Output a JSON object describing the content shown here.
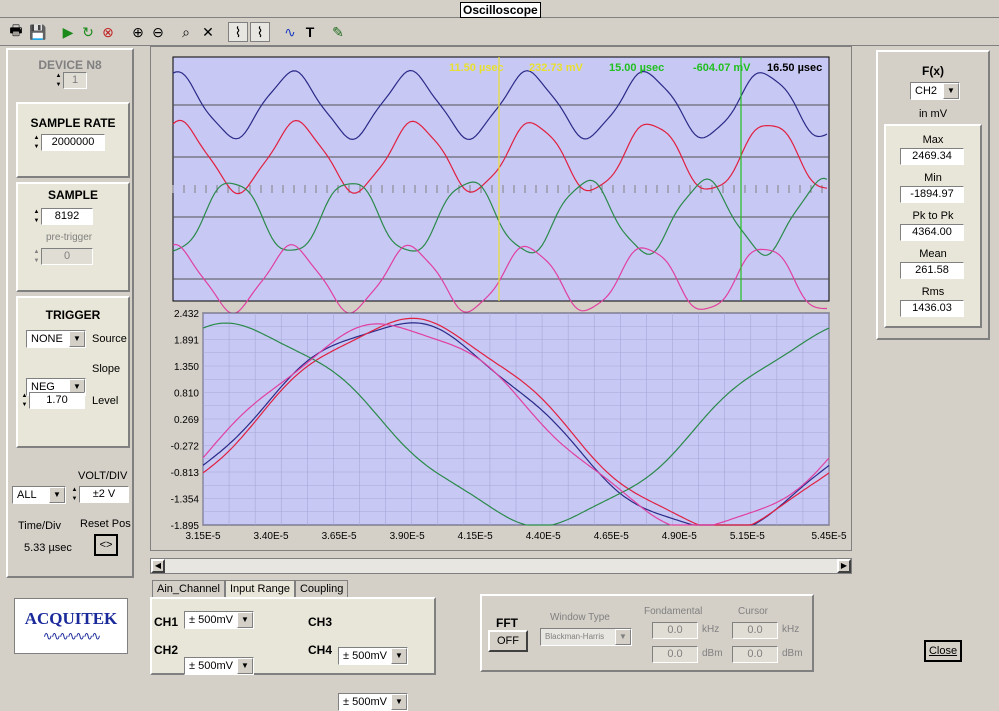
{
  "window": {
    "title": "Oscilloscope"
  },
  "toolbar": [
    "print-icon",
    "save-icon",
    "play-icon",
    "step-icon",
    "stop-icon",
    "zoom-in-icon",
    "zoom-out-icon",
    "zoom-icon",
    "cross-icon",
    "cursor1-icon",
    "cursor2-icon",
    "wave-icon",
    "text-icon",
    "pin-icon"
  ],
  "device": {
    "label": "DEVICE N8",
    "value": "1"
  },
  "sample_rate": {
    "label": "SAMPLE RATE",
    "value": "2000000"
  },
  "sample": {
    "label": "SAMPLE",
    "value": "8192",
    "pretrigger_label": "pre-trigger",
    "pretrigger_value": "0"
  },
  "trigger": {
    "label": "TRIGGER",
    "source": "NONE",
    "source_label": "Source",
    "slope": "NEG",
    "slope_label": "Slope",
    "level": "1.70",
    "level_label": "Level"
  },
  "volt": {
    "label": "VOLT/DIV",
    "channel": "ALL",
    "value": "±2 V"
  },
  "timediv": {
    "label": "Time/Div",
    "value": "5.33 µsec",
    "reset_label": "Reset Pos",
    "reset_symbol": "<>"
  },
  "logo": {
    "text": "ACQUITEK"
  },
  "cursors": {
    "c1_time": "11.50 µsec",
    "c1_volt": "232.73 mV",
    "c2_time": "15.00 µsec",
    "c2_volt": "-604.07 mV",
    "delta": "16.50 µsec",
    "c1_color": "#e8e030",
    "c2_color": "#20c020"
  },
  "colors": {
    "bg": "#c8c8f4",
    "ch1": "#2a2a88",
    "ch2": "#e02040",
    "ch3": "#2a8a4a",
    "ch4": "#e040a0"
  },
  "chart_data": {
    "type": "line",
    "x": [
      "3.15E-5",
      "3.40E-5",
      "3.65E-5",
      "3.90E-5",
      "4.15E-5",
      "4.40E-5",
      "4.65E-5",
      "4.90E-5",
      "5.15E-5",
      "5.45E-5"
    ],
    "y_ticks": [
      "2.432",
      "1.891",
      "1.350",
      "0.810",
      "0.269",
      "-0.272",
      "-0.813",
      "-1.354",
      "-1.895"
    ],
    "ylim": [
      -1.895,
      2.432
    ],
    "xlim": [
      3.15e-05,
      5.45e-05
    ],
    "period": 2.3e-05,
    "series": [
      {
        "color": "#2a2a88",
        "amplitude": 2.1,
        "offset": 0.1,
        "phase_x": 3.87e-05
      },
      {
        "color": "#e02040",
        "amplitude": 2.1,
        "offset": 0.15,
        "phase_x": 3.9e-05
      },
      {
        "color": "#2a8a4a",
        "amplitude": 2.0,
        "offset": 0.15,
        "phase_x": 3.25e-05
      },
      {
        "color": "#e040a0",
        "amplitude": 2.05,
        "offset": 0.12,
        "phase_x": 3.84e-05
      }
    ]
  },
  "tabs": [
    "Ain_Channel",
    "Input Range",
    "Coupling"
  ],
  "ranges": [
    {
      "ch": "CH1",
      "value": "± 500mV"
    },
    {
      "ch": "CH2",
      "value": "± 500mV"
    },
    {
      "ch": "CH3",
      "value": "± 500mV"
    },
    {
      "ch": "CH4",
      "value": "± 500mV"
    }
  ],
  "fft": {
    "label": "FFT",
    "state": "OFF",
    "window_label": "Window Type",
    "window_value": "Blackman-Harris",
    "fund_label": "Fondamental",
    "cursor_label": "Cursor",
    "khz": "kHz",
    "dbm": "dBm",
    "v1": "0.0",
    "v2": "0.0",
    "v3": "0.0",
    "v4": "0.0"
  },
  "fx": {
    "label": "F(x)",
    "channel": "CH2",
    "unit": "in mV",
    "stats": [
      {
        "label": "Max",
        "value": "2469.34"
      },
      {
        "label": "Min",
        "value": "-1894.97"
      },
      {
        "label": "Pk to Pk",
        "value": "4364.00"
      },
      {
        "label": "Mean",
        "value": "261.58"
      },
      {
        "label": "Rms",
        "value": "1436.03"
      }
    ]
  },
  "close_label": "Close"
}
